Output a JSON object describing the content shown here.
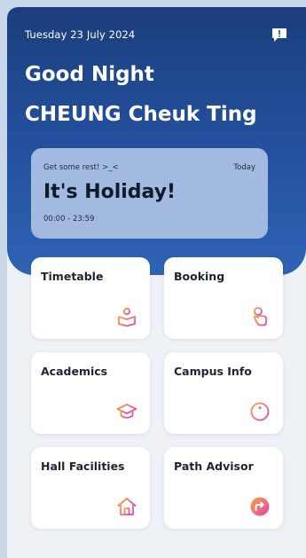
{
  "header": {
    "date": "Tuesday 23 July 2024",
    "greeting": "Good Night",
    "user_name": "CHEUNG Cheuk Ting"
  },
  "event_card": {
    "message": "Get some rest! >_<",
    "day": "Today",
    "title": "It's Holiday!",
    "time": "00:00 - 23:59"
  },
  "tiles": [
    {
      "label": "Timetable",
      "icon": "book-reader-icon"
    },
    {
      "label": "Booking",
      "icon": "tap-hand-icon"
    },
    {
      "label": "Academics",
      "icon": "graduation-cap-icon"
    },
    {
      "label": "Campus Info",
      "icon": "info-icon"
    },
    {
      "label": "Hall Facilities",
      "icon": "home-icon"
    },
    {
      "label": "Path Advisor",
      "icon": "direction-arrow-icon"
    }
  ],
  "colors": {
    "header_top": "#1b3e7c",
    "header_bottom": "#2f63b5",
    "event_card": "#a2bae0",
    "icon_gradient_start": "#f7a43a",
    "icon_gradient_end": "#e63fb8"
  }
}
